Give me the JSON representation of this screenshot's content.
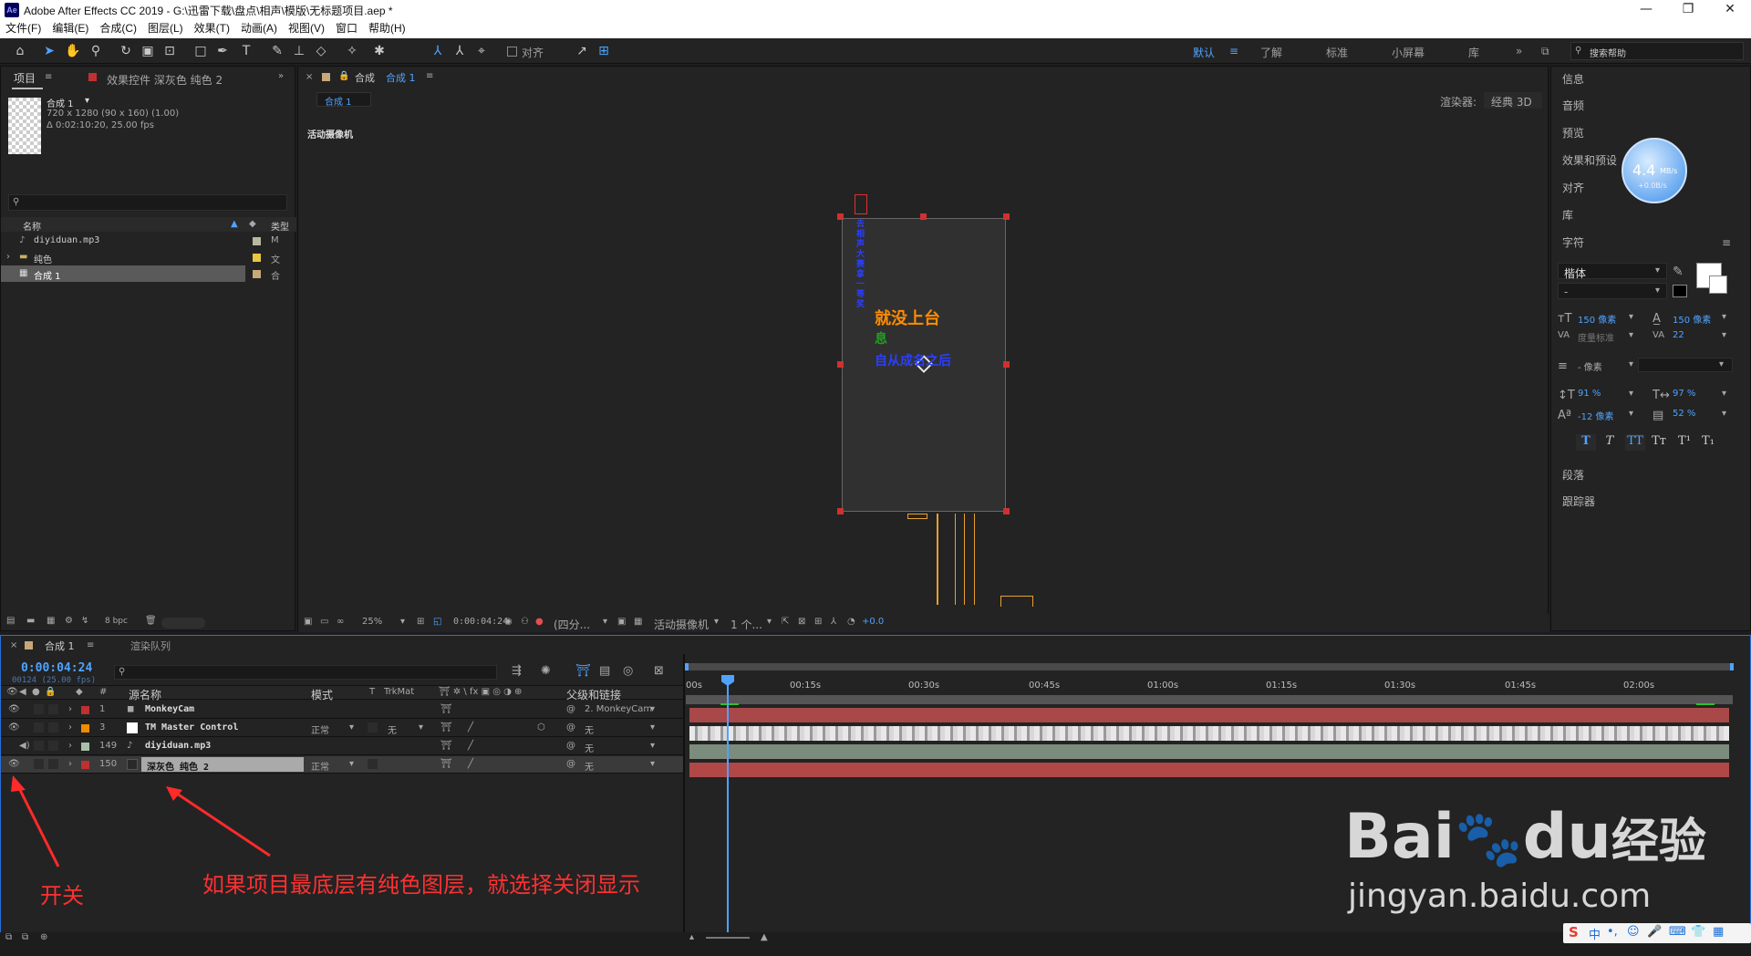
{
  "window": {
    "title": "Adobe After Effects CC 2019 - G:\\迅雷下载\\盘点\\相声\\模版\\无标题项目.aep *",
    "logo": "Ae"
  },
  "menu": [
    "文件(F)",
    "编辑(E)",
    "合成(C)",
    "图层(L)",
    "效果(T)",
    "动画(A)",
    "视图(V)",
    "窗口",
    "帮助(H)"
  ],
  "toolbar": {
    "align_label": "对齐",
    "workspaces": [
      "默认",
      "了解",
      "标准",
      "小屏幕",
      "库"
    ],
    "search_placeholder": "搜索帮助"
  },
  "project": {
    "tab": "项目",
    "effects_tab": "效果控件 深灰色 纯色 2",
    "comp_name": "合成 1",
    "comp_info1": "720 x 1280  (90 x 160) (1.00)",
    "comp_info2": "Δ 0:02:10:20, 25.00 fps",
    "col_name": "名称",
    "col_type": "类型",
    "items": [
      {
        "name": "diyiduan.mp3",
        "type": "M",
        "color": "#b8b8a0"
      },
      {
        "name": "纯色",
        "type": "文",
        "color": "#e8c840"
      },
      {
        "name": "合成 1",
        "type": "合",
        "color": "#c8a878"
      }
    ],
    "bpc": "8 bpc"
  },
  "comp": {
    "tab_prefix": "合成",
    "tab_name": "合成 1",
    "subtab": "合成 1",
    "renderer_label": "渲染器:",
    "renderer_value": "经典 3D",
    "camera_label": "活动摄像机",
    "canvas_text1": "就没上台",
    "canvas_text2": "息",
    "canvas_text3": "自从成名之后",
    "canvas_vertical": "去相声大赛拿一等奖",
    "zoom": "25%",
    "timecode": "0:00:04:24",
    "resolution": "(四分...",
    "view": "活动摄像机",
    "views_count": "1 个...",
    "exposure": "+0.0"
  },
  "right_panel": {
    "items": [
      "信息",
      "音频",
      "预览",
      "效果和预设",
      "对齐",
      "库",
      "字符",
      "段落",
      "跟踪器"
    ],
    "font": "楷体",
    "style": "-",
    "size": "150 像素",
    "leading": "150 像素",
    "kerning": "度量标准",
    "tracking": "22",
    "stroke": "- 像素",
    "vscale": "91 %",
    "hscale": "97 %",
    "baseline": "-12 像素",
    "tsume": "52 %",
    "style_buttons": [
      "T",
      "T",
      "TT",
      "Tт",
      "T¹",
      "T₁"
    ]
  },
  "speed_widget": {
    "value": "4.4",
    "unit": "MB/s",
    "sub": "+0.0B/s"
  },
  "timeline": {
    "tab": "合成 1",
    "render_queue": "渲染队列",
    "timecode": "0:00:04:24",
    "frame_info": "00124 (25.00 fps)",
    "headers": {
      "num": "#",
      "source": "源名称",
      "mode": "模式",
      "t": "T",
      "trkmat": "TrkMat",
      "parent": "父级和链接"
    },
    "ruler": [
      "00s",
      "00:15s",
      "00:30s",
      "00:45s",
      "01:00s",
      "01:15s",
      "01:30s",
      "01:45s",
      "02:00s"
    ],
    "layers": [
      {
        "num": "1",
        "name": "MonkeyCam",
        "mode": "",
        "trkmat": "",
        "parent": "2. MonkeyCam",
        "color": "#c03030"
      },
      {
        "num": "3",
        "name": "TM Master Control",
        "mode": "正常",
        "trkmat": "无",
        "parent": "无",
        "color": "#f08c00"
      },
      {
        "num": "149",
        "name": "diyiduan.mp3",
        "mode": "",
        "trkmat": "",
        "parent": "无",
        "color": "#a8c0a8"
      },
      {
        "num": "150",
        "name": "深灰色 纯色 2",
        "mode": "正常",
        "trkmat": "",
        "parent": "无",
        "color": "#c03030"
      }
    ]
  },
  "annotations": {
    "switch": "开关",
    "note": "如果项目最底层有纯色图层，就选择关闭显示"
  },
  "watermark": {
    "brand": "Bai",
    "brand2": "du",
    "brand3": "经验",
    "url": "jingyan.baidu.com"
  },
  "taskbar": {
    "ime": "中"
  }
}
